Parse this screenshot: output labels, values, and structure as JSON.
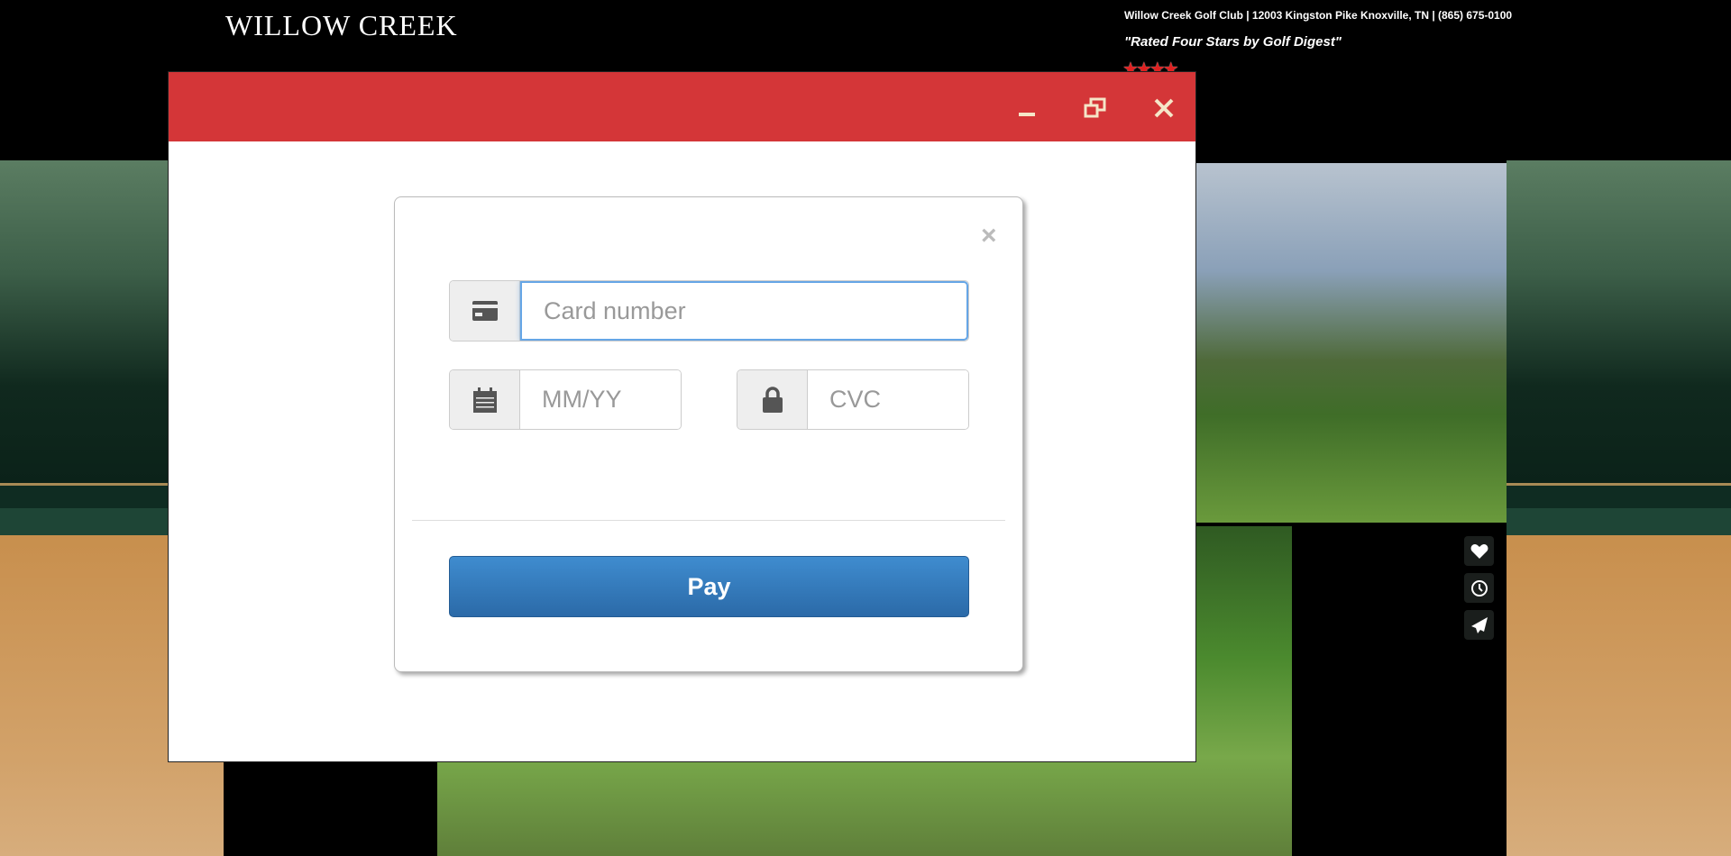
{
  "site": {
    "logo": "WILLOW CREEK",
    "info": "Willow Creek Golf Club | 12003 Kingston Pike Knoxville, TN | (865) 675-0100",
    "tagline": "\"Rated Four Stars by Golf Digest\"",
    "stars": "★★★★",
    "rating": 4
  },
  "side_icons": [
    "heart-icon",
    "clock-icon",
    "send-icon"
  ],
  "window": {
    "controls": [
      "minimize",
      "restore",
      "close"
    ]
  },
  "payment": {
    "close": "×",
    "card_placeholder": "Card number",
    "expiry_placeholder": "MM/YY",
    "cvc_placeholder": "CVC",
    "pay_label": "Pay"
  },
  "colors": {
    "titlebar": "#d43638",
    "pay": "#337ab7",
    "focus": "#66a6e6"
  }
}
